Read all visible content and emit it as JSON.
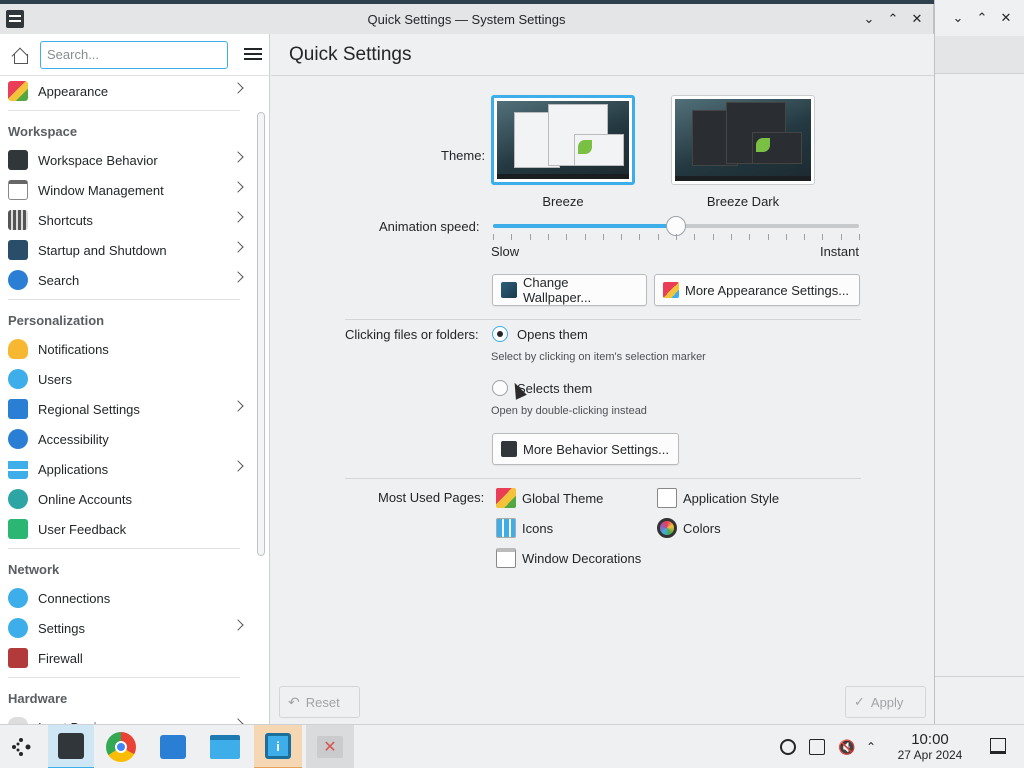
{
  "window": {
    "title": "Quick Settings — System Settings"
  },
  "sidebar": {
    "search_placeholder": "Search...",
    "items": [
      {
        "label": "Appearance"
      },
      {
        "section": "Workspace"
      },
      {
        "label": "Workspace Behavior"
      },
      {
        "label": "Window Management"
      },
      {
        "label": "Shortcuts"
      },
      {
        "label": "Startup and Shutdown"
      },
      {
        "label": "Search"
      },
      {
        "section": "Personalization"
      },
      {
        "label": "Notifications"
      },
      {
        "label": "Users"
      },
      {
        "label": "Regional Settings"
      },
      {
        "label": "Accessibility"
      },
      {
        "label": "Applications"
      },
      {
        "label": "Online Accounts"
      },
      {
        "label": "User Feedback"
      },
      {
        "section": "Network"
      },
      {
        "label": "Connections"
      },
      {
        "label": "Settings"
      },
      {
        "label": "Firewall"
      },
      {
        "section": "Hardware"
      },
      {
        "label": "Input Devices"
      }
    ]
  },
  "main": {
    "page_title": "Quick Settings",
    "theme": {
      "label": "Theme:",
      "options": [
        {
          "name": "Breeze",
          "selected": true
        },
        {
          "name": "Breeze Dark",
          "selected": false
        }
      ]
    },
    "animation": {
      "label": "Animation speed:",
      "min_label": "Slow",
      "max_label": "Instant",
      "value_fraction": 0.5
    },
    "change_wallpaper": "Change Wallpaper...",
    "more_appearance": "More Appearance Settings...",
    "clicking": {
      "label": "Clicking files or folders:",
      "opens": "Opens them",
      "opens_hint": "Select by clicking on item's selection marker",
      "selects": "Selects them",
      "selects_hint": "Open by double-clicking instead",
      "selected": "opens"
    },
    "more_behavior": "More Behavior Settings...",
    "most_used": {
      "label": "Most Used Pages:",
      "pages": [
        "Global Theme",
        "Application Style",
        "Icons",
        "Colors",
        "Window Decorations"
      ]
    },
    "reset": "Reset",
    "apply": "Apply"
  },
  "taskbar": {
    "time": "10:00",
    "date": "27 Apr 2024"
  },
  "colors": {
    "accent": "#3daee9"
  }
}
